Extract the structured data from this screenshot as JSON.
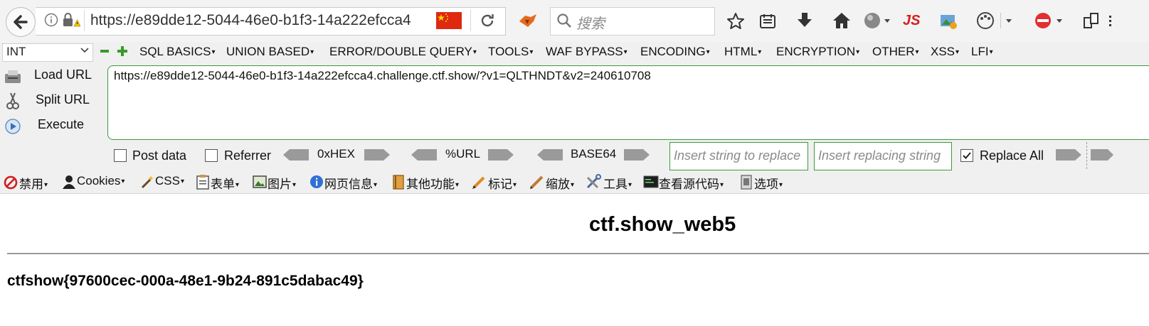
{
  "browser": {
    "url_display": "https://e89dde12-5044-46e0-b1f3-14a222efcca4",
    "search_placeholder": "搜索",
    "js_icon_label": "JS"
  },
  "hackbar": {
    "injection_type": "INT",
    "menus": [
      "SQL BASICS",
      "UNION BASED",
      "ERROR/DOUBLE QUERY",
      "TOOLS",
      "WAF BYPASS",
      "ENCODING",
      "HTML",
      "ENCRYPTION",
      "OTHER",
      "XSS",
      "LFI"
    ],
    "load_url_label": "Load URL",
    "split_url_label": "Split URL",
    "execute_label": "Execute",
    "url_value": "https://e89dde12-5044-46e0-b1f3-14a222efcca4.challenge.ctf.show/?v1=QLTHNDT&v2=240610708",
    "post_data_label": "Post data",
    "referrer_label": "Referrer",
    "hex_label": "0xHEX",
    "url_enc_label": "%URL",
    "base64_label": "BASE64",
    "replace_from_placeholder": "Insert string to replace",
    "replace_to_placeholder": "Insert replacing string",
    "replace_all_label": "Replace All",
    "replace_all_checked": true,
    "accent_color": "#3c9a3c"
  },
  "webdev_toolbar": {
    "items": [
      "禁用",
      "Cookies",
      "CSS",
      "表单",
      "图片",
      "网页信息",
      "其他功能",
      "标记",
      "缩放",
      "工具",
      "查看源代码",
      "选项"
    ]
  },
  "page": {
    "title": "ctf.show_web5",
    "flag": "ctfshow{97600cec-000a-48e1-9b24-891c5dabac49}"
  }
}
